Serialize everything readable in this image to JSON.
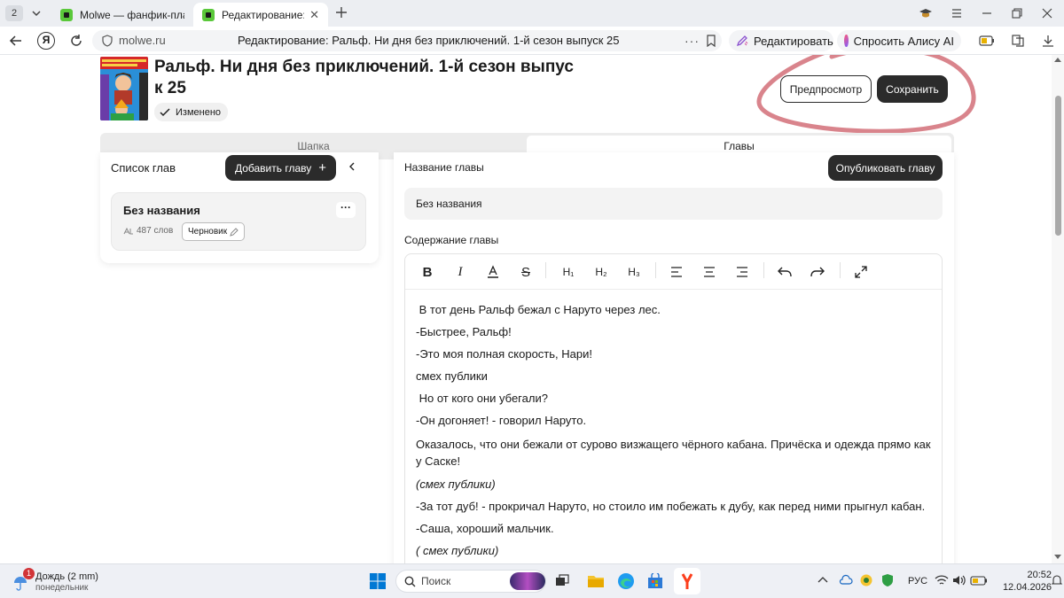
{
  "browser": {
    "tab_count": "2",
    "tabs": [
      {
        "label": "Molwe — фанфик-платфо"
      },
      {
        "label": "Редактирование: Ральф"
      }
    ],
    "url": "molwe.ru",
    "page_title": "Редактирование: Ральф. Ни дня без приключений. 1-й сезон выпуск 25",
    "edit_label": "Редактировать",
    "alice_label": "Спросить Алису AI"
  },
  "header": {
    "title_line1": "Ральф. Ни дня без приключений. 1-й сезон выпус",
    "title_line2": "к 25",
    "status_label": "Изменено",
    "preview_label": "Предпросмотр",
    "save_label": "Сохранить"
  },
  "tabs": {
    "header_tab": "Шапка",
    "chapters_tab": "Главы"
  },
  "sidebar": {
    "title": "Список глав",
    "add_label": "Добавить главу",
    "chapter": {
      "name": "Без названия",
      "words": "487 слов",
      "status": "Черновик"
    }
  },
  "editor": {
    "chapter_name_label": "Название главы",
    "publish_label": "Опубликовать главу",
    "chapter_name_value": "Без названия",
    "content_label": "Содержание главы",
    "toolbar": {
      "h1": "H₁",
      "h2": "H₂",
      "h3": "H₃"
    },
    "paragraphs": [
      " В тот день Ральф бежал с Наруто через лес.",
      "-Быстрее, Ральф!",
      "-Это моя полная скорость, Нари!",
      "смех публики",
      " Но от кого они убегали?",
      "-Он догоняет! - говорил Наруто.",
      "Оказалось, что они бежали от сурово визжащего чёрного кабана. Причёска и одежда прямо как у Саске!",
      "(смех публики)",
      "-За тот дуб! - прокричал Наруто, но стоило им побежать к дубу, как перед ними прыгнул кабан.",
      "-Саша, хороший мальчик.",
      "( смех публики)"
    ]
  },
  "taskbar": {
    "weather_badge": "1",
    "weather_text": "Дождь (2 mm)",
    "weather_day": "понедельник",
    "search_label": "Поиск",
    "lang": "РУС",
    "time": "20:52",
    "date": "12.04.2026"
  },
  "colors": {
    "annotation_circle": "#d9848c",
    "favicon_green": "#5ac83a",
    "yandex_red": "#fc3f1d"
  }
}
